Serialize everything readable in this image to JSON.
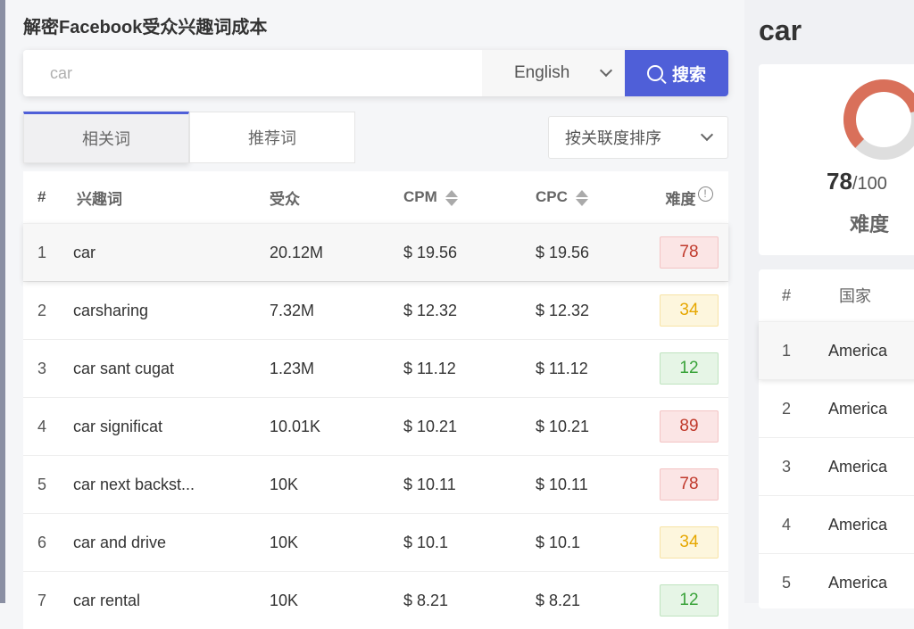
{
  "page_title": "解密Facebook受众兴趣词成本",
  "search": {
    "value": "",
    "placeholder": "car",
    "language": "English",
    "button_label": "搜索"
  },
  "tabs": [
    {
      "label": "相关词"
    },
    {
      "label": "推荐词"
    }
  ],
  "sort": {
    "label": "按关联度排序"
  },
  "table": {
    "headers": {
      "num": "#",
      "keyword": "兴趣词",
      "audience": "受众",
      "cpm": "CPM",
      "cpc": "CPC",
      "difficulty": "难度"
    },
    "rows": [
      {
        "num": "1",
        "keyword": "car",
        "audience": "20.12M",
        "cpm": "$ 19.56",
        "cpc": "$ 19.56",
        "difficulty": "78",
        "level": "red"
      },
      {
        "num": "2",
        "keyword": "carsharing",
        "audience": "7.32M",
        "cpm": "$ 12.32",
        "cpc": "$ 12.32",
        "difficulty": "34",
        "level": "yellow"
      },
      {
        "num": "3",
        "keyword": "car sant cugat",
        "audience": "1.23M",
        "cpm": "$ 11.12",
        "cpc": "$ 11.12",
        "difficulty": "12",
        "level": "green"
      },
      {
        "num": "4",
        "keyword": "car significat",
        "audience": "10.01K",
        "cpm": "$ 10.21",
        "cpc": "$ 10.21",
        "difficulty": "89",
        "level": "red"
      },
      {
        "num": "5",
        "keyword": "car next backst...",
        "audience": "10K",
        "cpm": "$ 10.11",
        "cpc": "$ 10.11",
        "difficulty": "78",
        "level": "red"
      },
      {
        "num": "6",
        "keyword": "car and drive",
        "audience": "10K",
        "cpm": "$ 10.1",
        "cpc": "$ 10.1",
        "difficulty": "34",
        "level": "yellow"
      },
      {
        "num": "7",
        "keyword": "car rental",
        "audience": "10K",
        "cpm": "$ 8.21",
        "cpc": "$ 8.21",
        "difficulty": "12",
        "level": "green"
      }
    ]
  },
  "detail": {
    "keyword": "car",
    "score": "78",
    "score_total": "/100",
    "score_fraction": 0.78,
    "difficulty_label": "难度",
    "gauge_color": "#d9705a",
    "country_headers": {
      "num": "#",
      "country": "国家"
    },
    "countries": [
      {
        "num": "1",
        "name": "America"
      },
      {
        "num": "2",
        "name": "America"
      },
      {
        "num": "3",
        "name": "America"
      },
      {
        "num": "4",
        "name": "America"
      },
      {
        "num": "5",
        "name": "America"
      }
    ]
  },
  "colors": {
    "accent": "#4f5fd8",
    "red": "#c0392b",
    "yellow": "#e6a700",
    "green": "#3aa33a"
  }
}
